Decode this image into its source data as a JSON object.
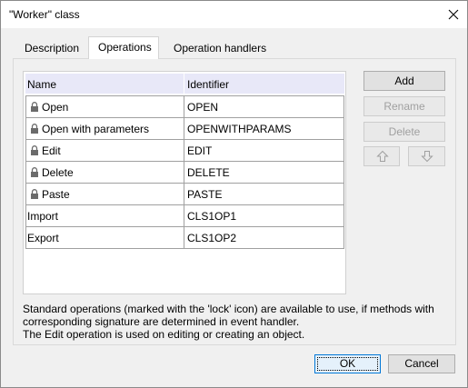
{
  "window": {
    "title": "\"Worker\" class"
  },
  "tabs": [
    {
      "label": "Description"
    },
    {
      "label": "Operations",
      "active": true
    },
    {
      "label": "Operation handlers"
    }
  ],
  "grid": {
    "columns": [
      "Name",
      "Identifier"
    ],
    "rows": [
      {
        "name": "Open",
        "identifier": "OPEN",
        "locked": true
      },
      {
        "name": "Open with parameters",
        "identifier": "OPENWITHPARAMS",
        "locked": true
      },
      {
        "name": "Edit",
        "identifier": "EDIT",
        "locked": true
      },
      {
        "name": "Delete",
        "identifier": "DELETE",
        "locked": true
      },
      {
        "name": "Paste",
        "identifier": "PASTE",
        "locked": true
      },
      {
        "name": "Import",
        "identifier": "CLS1OP1",
        "locked": false
      },
      {
        "name": "Export",
        "identifier": "CLS1OP2",
        "locked": false
      }
    ]
  },
  "side_buttons": {
    "add": "Add",
    "rename": "Rename",
    "delete": "Delete"
  },
  "notes": {
    "line1": "Standard operations (marked with the 'lock' icon) are available to use, if methods with",
    "line2": "corresponding signature are determined in event handler.",
    "line3": "The Edit operation is used on editing or creating an object."
  },
  "footer": {
    "ok": "OK",
    "cancel": "Cancel"
  },
  "icons": {
    "close": "close-icon",
    "lock": "lock-icon",
    "up": "arrow-up-icon",
    "down": "arrow-down-icon"
  }
}
